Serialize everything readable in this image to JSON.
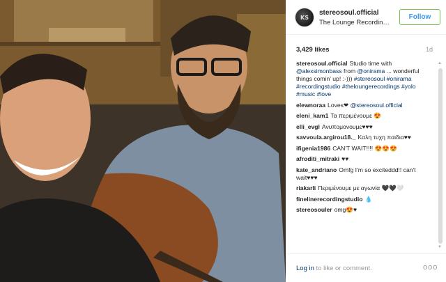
{
  "post": {
    "username": "stereosoul.official",
    "location": "The Lounge Recording...",
    "follow_label": "Follow",
    "likes": "3,429 likes",
    "time_ago": "1d",
    "avatar_text": "KS"
  },
  "caption": {
    "author": "stereosoul.official",
    "text_parts": [
      {
        "t": "Studio time with ",
        "link": false
      },
      {
        "t": "@alexsimonbass",
        "link": true
      },
      {
        "t": " from ",
        "link": false
      },
      {
        "t": "@onirama",
        "link": true
      },
      {
        "t": " ... wonderful things comin' up! :-)))",
        "link": false
      },
      {
        "t": " #stereosoul #onirama #recordingstudio #theloungerecordings #yolo #music #love",
        "link": true
      }
    ]
  },
  "comments": [
    {
      "author": "elewnoraa",
      "text": "Loves❤ ",
      "mention": "@stereosoul.official"
    },
    {
      "author": "eleni_kam1",
      "text": "Τα περιμένουμε 😍",
      "mention": ""
    },
    {
      "author": "elli_evgl",
      "text": "Ανυπομονουμε♥♥♥",
      "mention": ""
    },
    {
      "author": "savvoula.argirou18._",
      "text": "Καλη τυχη παιδια♥♥",
      "mention": ""
    },
    {
      "author": "ifigenia1986",
      "text": "CAN'T WAIT!!!! 😍😍😍",
      "mention": ""
    },
    {
      "author": "afroditi_mitraki",
      "text": "♥♥",
      "mention": ""
    },
    {
      "author": "kate_andriano",
      "text": "Omfg I'm so exciteddd!! can't wait♥♥♥",
      "mention": ""
    },
    {
      "author": "riakarli",
      "text": "Περιμένουμε με αγωνία 🖤🖤🤍",
      "mention": ""
    },
    {
      "author": "finelinerecordingstudio",
      "text": "💧",
      "mention": ""
    },
    {
      "author": "stereosouler",
      "text": "omg😍♥",
      "mention": ""
    }
  ],
  "footer": {
    "login_link": "Log in",
    "login_rest": " to like or comment.",
    "more_icon": "ooo"
  },
  "icons": {
    "scroll_up": "up-arrow-icon",
    "scroll_down": "down-arrow-icon",
    "more": "more-options-icon"
  },
  "colors": {
    "follow_text": "#3897f0",
    "follow_border": "#70c050",
    "link": "#003569"
  }
}
